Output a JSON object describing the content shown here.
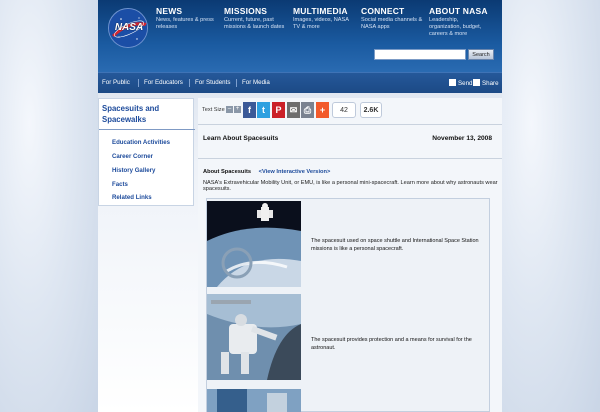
{
  "header": {
    "logo_text": "NASA",
    "nav": [
      {
        "title": "NEWS",
        "desc": "News, features & press releases"
      },
      {
        "title": "MISSIONS",
        "desc": "Current, future, past missions & launch dates"
      },
      {
        "title": "MULTIMEDIA",
        "desc": "Images, videos, NASA TV & more"
      },
      {
        "title": "CONNECT",
        "desc": "Social media channels & NASA apps"
      },
      {
        "title": "ABOUT NASA",
        "desc": "Leadership, organization, budget, careers & more"
      }
    ],
    "search": {
      "placeholder": "",
      "button": "Search"
    }
  },
  "subnav": {
    "items": [
      "For Public",
      "For Educators",
      "For Students",
      "For Media"
    ],
    "send": "Send",
    "share": "Share"
  },
  "sidebar": {
    "title": "Spacesuits and Spacewalks",
    "links": [
      "Education Activities",
      "Career Corner",
      "History Gallery",
      "Facts",
      "Related Links"
    ]
  },
  "toolbar": {
    "text_size_label": "Text Size",
    "social": [
      {
        "icon": "facebook-icon",
        "glyph": "f",
        "color": "#3b5998"
      },
      {
        "icon": "twitter-icon",
        "glyph": "t",
        "color": "#2ea0e0"
      },
      {
        "icon": "pinterest-icon",
        "glyph": "P",
        "color": "#cb2027"
      },
      {
        "icon": "email-icon",
        "glyph": "✉",
        "color": "#6d6d6d"
      },
      {
        "icon": "print-icon",
        "glyph": "⎙",
        "color": "#7a8290"
      },
      {
        "icon": "add-icon",
        "glyph": "+",
        "color": "#f25a2b"
      }
    ],
    "count": "42",
    "share_count": "2.6K"
  },
  "page": {
    "title": "Learn About Spacesuits",
    "date": "November 13, 2008",
    "about_label": "About Spacesuits",
    "interactive_link": "<View Interactive Version>",
    "description": "NASA's Extravehicular Mobility Unit, or EMU, is like a personal mini-spacecraft. Learn more about why astronauts wear spacesuits."
  },
  "gallery": [
    {
      "caption": "The spacesuit used on space shuttle and International Space Station missions is like a personal spacecraft."
    },
    {
      "caption": "The spacesuit provides protection and a means for survival for the astronaut."
    }
  ],
  "colors": {
    "header": "#1a5aa0",
    "link": "#1c4a9b",
    "nasa_red": "#d22630"
  }
}
